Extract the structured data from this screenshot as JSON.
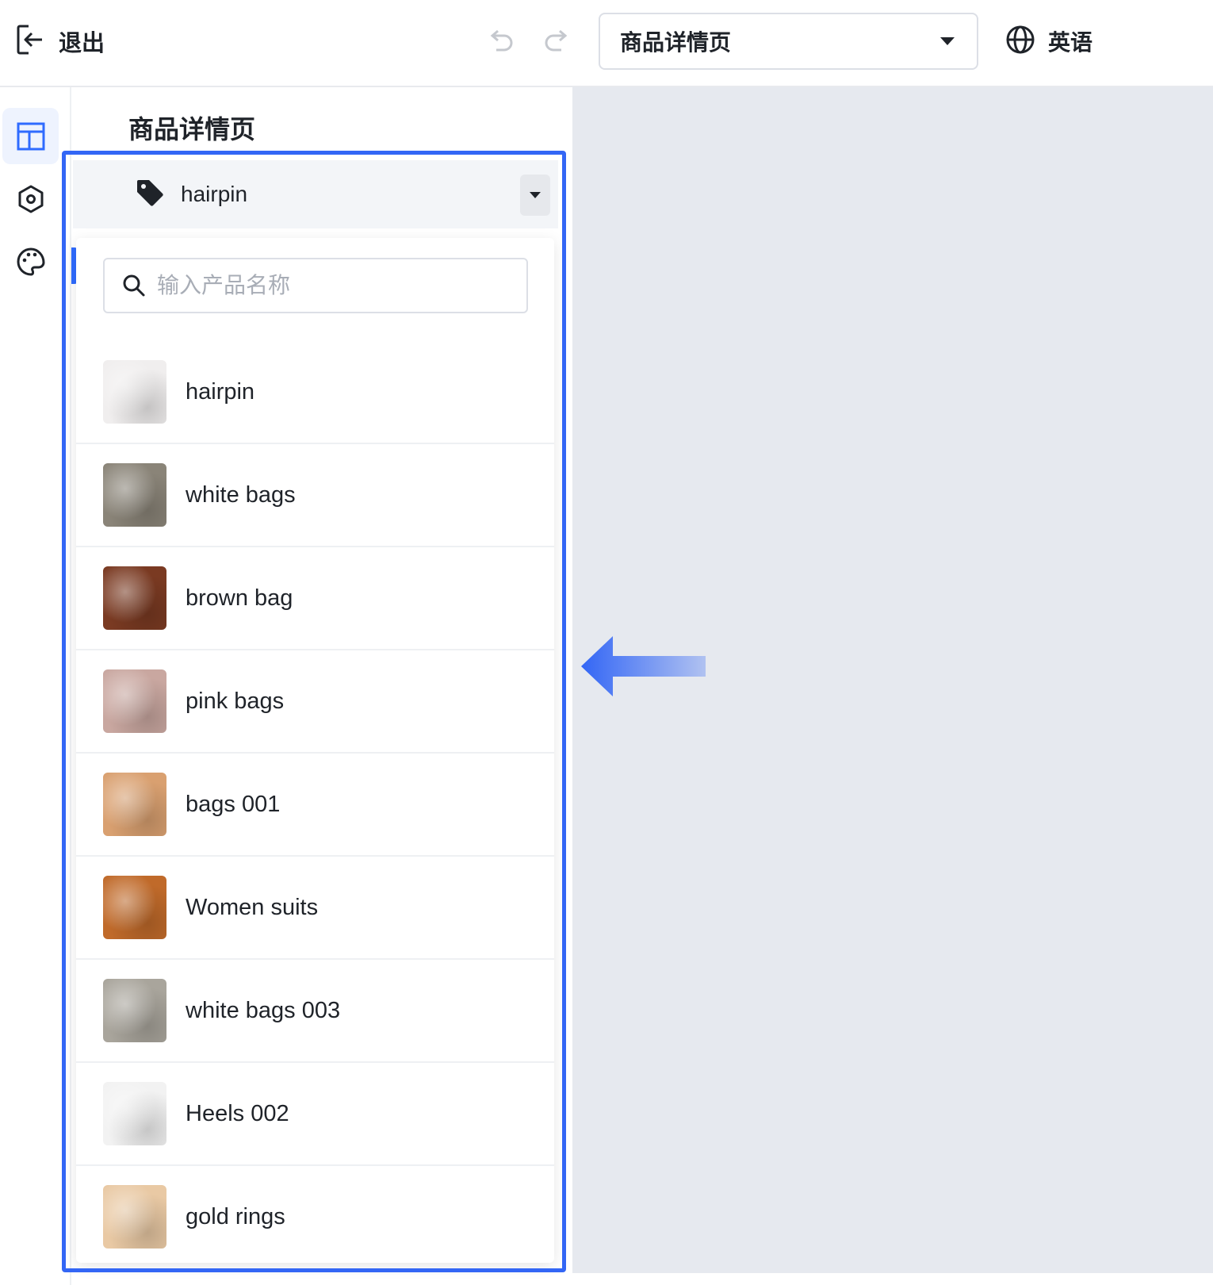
{
  "topbar": {
    "exit_label": "退出",
    "page_select_value": "商品详情页",
    "language_label": "英语"
  },
  "rail": {
    "items": [
      {
        "icon": "layout-icon",
        "active": true
      },
      {
        "icon": "settings-hexagon-icon",
        "active": false
      },
      {
        "icon": "palette-icon",
        "active": false
      }
    ]
  },
  "panel": {
    "title": "商品详情页",
    "product_select": {
      "icon": "tag-icon",
      "value": "hairpin"
    },
    "dropdown": {
      "search_placeholder": "输入产品名称",
      "search_value": "",
      "items": [
        {
          "name": "hairpin",
          "thumb_color": "#f0eeee"
        },
        {
          "name": "white bags",
          "thumb_color": "#8a8478"
        },
        {
          "name": "brown bag",
          "thumb_color": "#7a3a22"
        },
        {
          "name": "pink bags",
          "thumb_color": "#c9a7a0"
        },
        {
          "name": "bags 001",
          "thumb_color": "#d9a070"
        },
        {
          "name": "Women suits",
          "thumb_color": "#c06a2a"
        },
        {
          "name": "white bags 003",
          "thumb_color": "#a9a59c"
        },
        {
          "name": "Heels 002",
          "thumb_color": "#f2f2f2"
        },
        {
          "name": "gold rings",
          "thumb_color": "#e9c9a4"
        }
      ]
    }
  },
  "annotation": {
    "highlight_color": "#3366f5",
    "arrow_color": "#3366f5"
  }
}
